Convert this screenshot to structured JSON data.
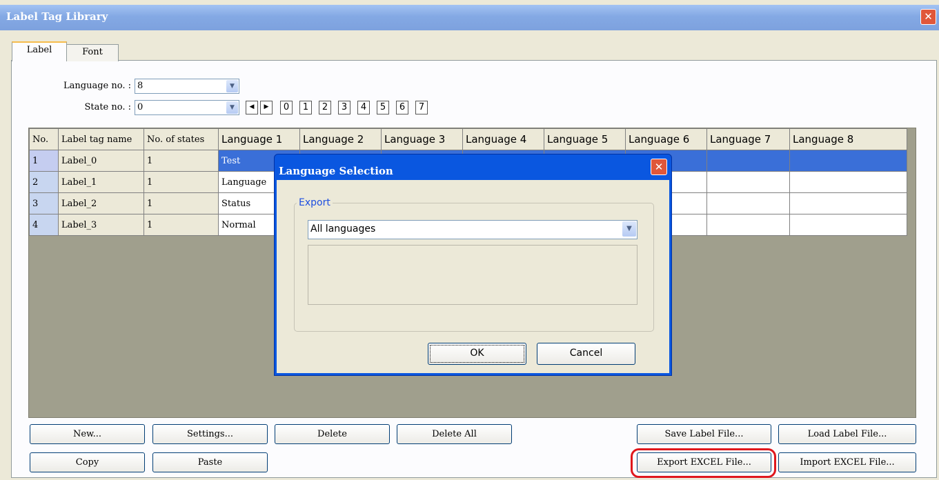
{
  "window": {
    "title": "Label Tag Library"
  },
  "tabs": [
    {
      "label": "Label"
    },
    {
      "label": "Font"
    }
  ],
  "controls": {
    "language_no_label": "Language no. :",
    "language_no_value": "8",
    "state_no_label": "State no. :",
    "state_no_value": "0",
    "nav_prev": "◀",
    "nav_next": "▶",
    "state_buttons": [
      "0",
      "1",
      "2",
      "3",
      "4",
      "5",
      "6",
      "7"
    ]
  },
  "table": {
    "columns": [
      "No.",
      "Label tag name",
      "No. of states",
      "Language 1",
      "Language 2",
      "Language 3",
      "Language 4",
      "Language 5",
      "Language 6",
      "Language 7",
      "Language 8"
    ],
    "rows": [
      {
        "no": "1",
        "name": "Label_0",
        "states": "1",
        "lang1": "Test"
      },
      {
        "no": "2",
        "name": "Label_1",
        "states": "1",
        "lang1": "Language"
      },
      {
        "no": "3",
        "name": "Label_2",
        "states": "1",
        "lang1": "Status"
      },
      {
        "no": "4",
        "name": "Label_3",
        "states": "1",
        "lang1": "Normal"
      }
    ]
  },
  "buttons": {
    "new": "New...",
    "settings": "Settings...",
    "delete": "Delete",
    "delete_all": "Delete All",
    "copy": "Copy",
    "paste": "Paste",
    "save_label": "Save Label File...",
    "load_label": "Load Label File...",
    "export_excel": "Export EXCEL File...",
    "import_excel": "Import EXCEL File..."
  },
  "dialog": {
    "title": "Language Selection",
    "group_label": "Export",
    "selected": "All languages",
    "ok": "OK",
    "cancel": "Cancel"
  },
  "colors": {
    "selection": "#3a6fd8",
    "dialog_frame": "#0a57e0",
    "highlight_ring": "#e0171c"
  }
}
